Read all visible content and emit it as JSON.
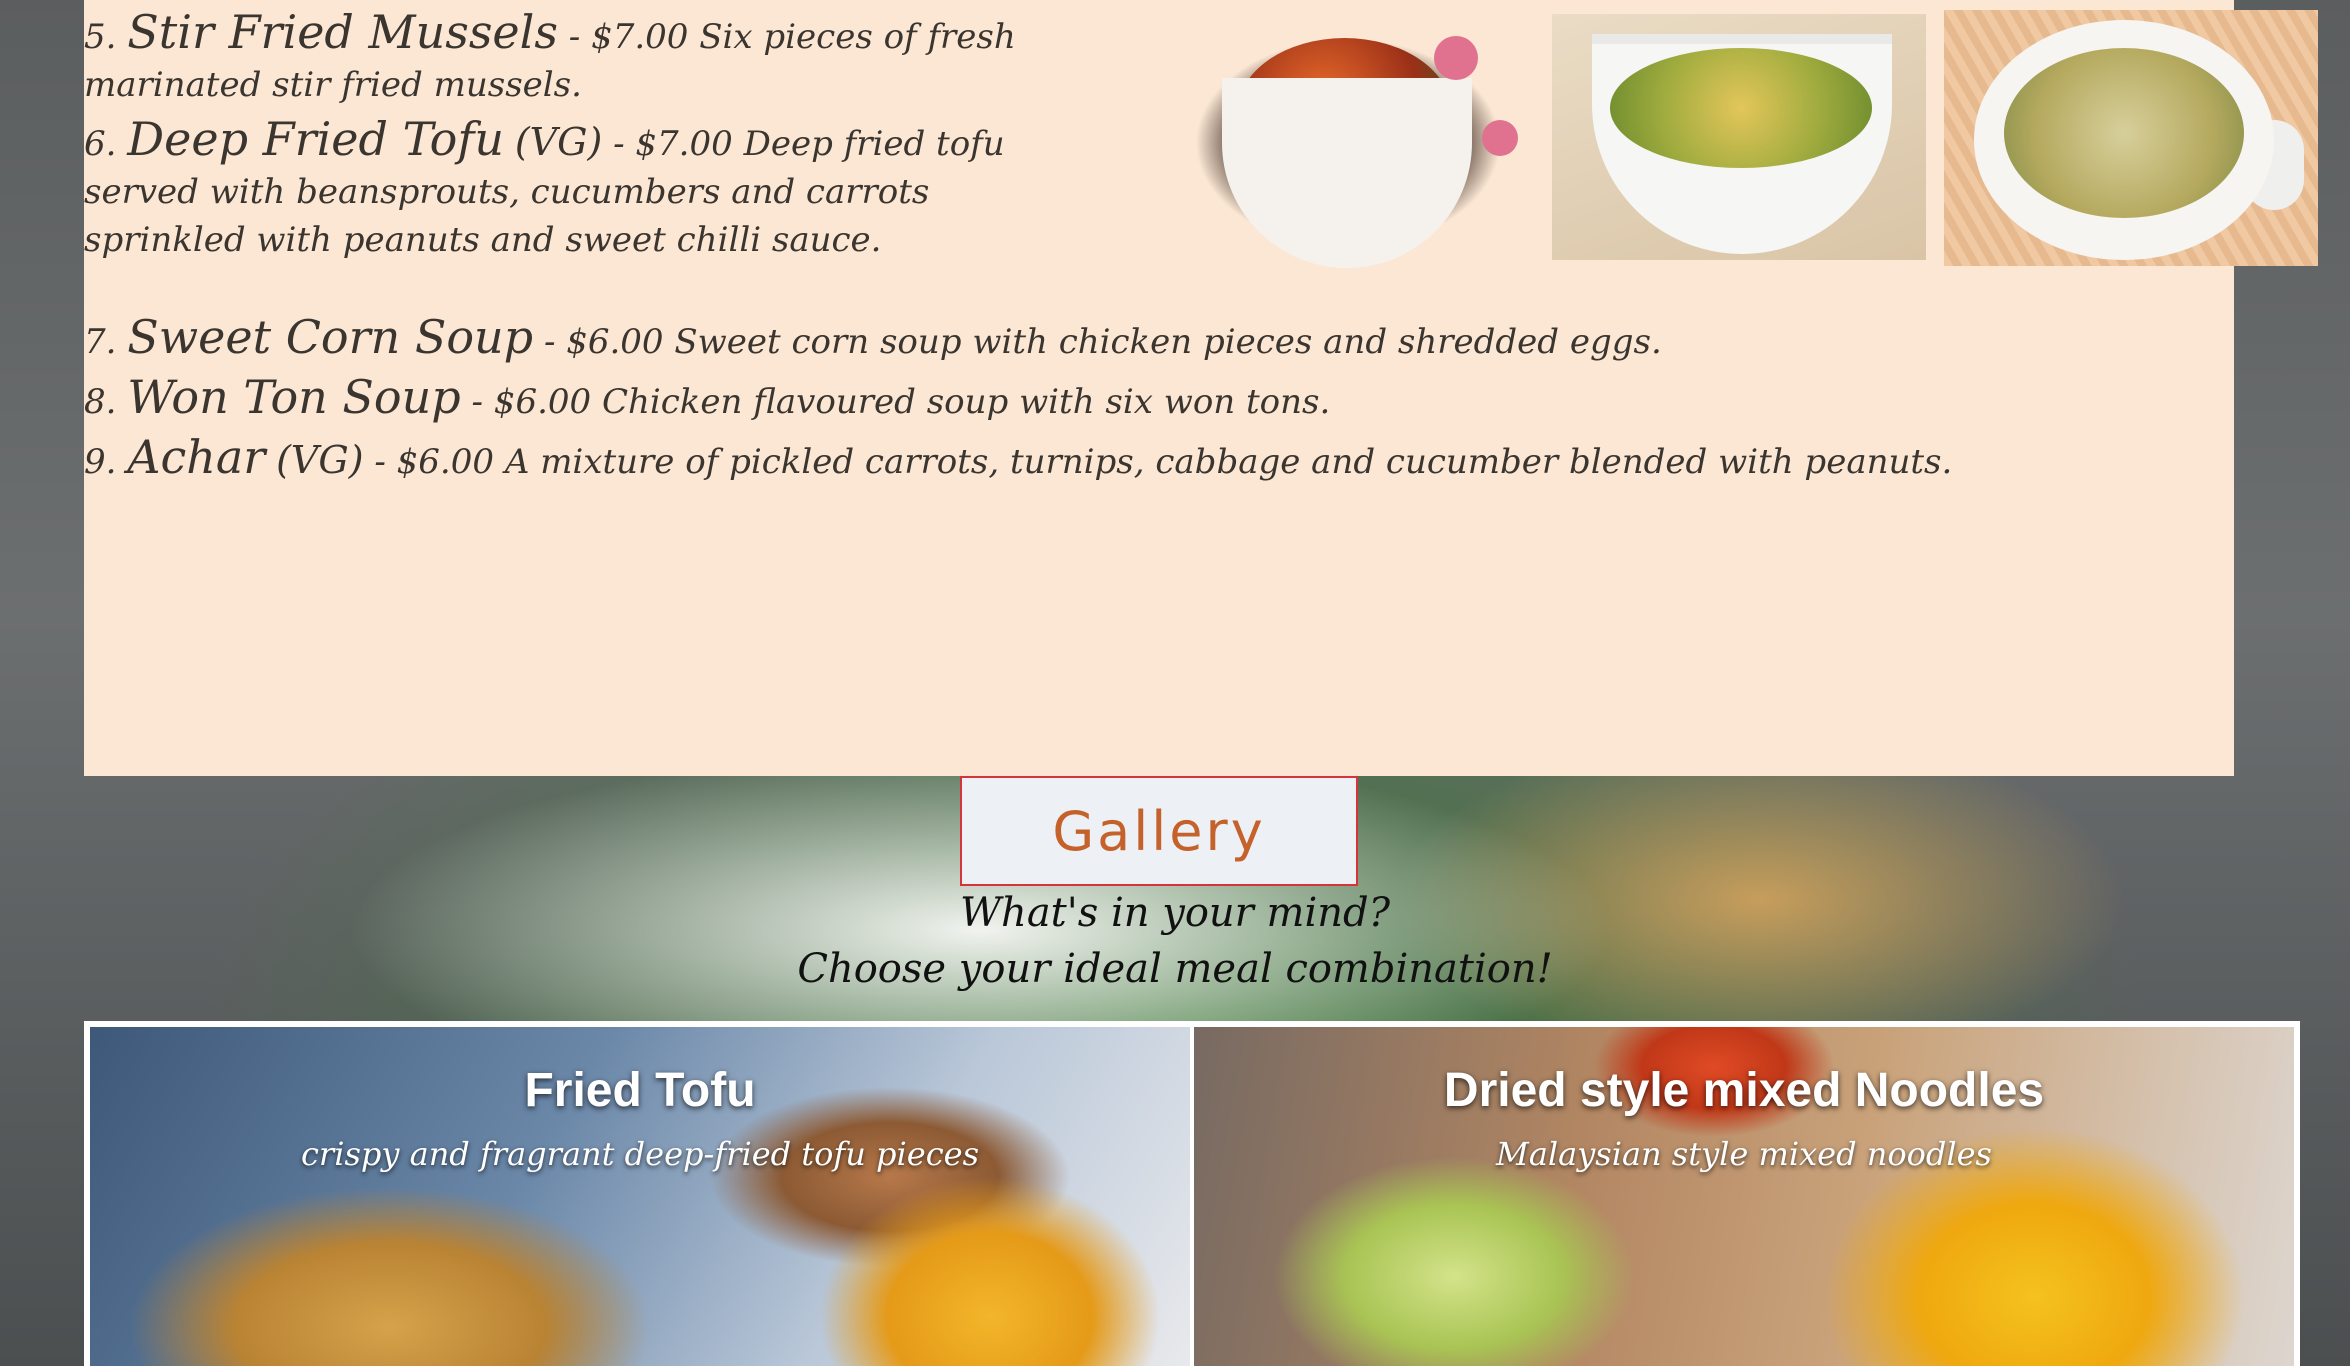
{
  "menu": {
    "items": [
      {
        "num": "5.",
        "name": "Stir Fried Mussels",
        "tag": "",
        "price": "- $7.00",
        "desc": "Six pieces of fresh marinated stir fried mussels."
      },
      {
        "num": "6.",
        "name": "Deep Fried Tofu",
        "tag": "(VG)",
        "price": "- $7.00",
        "desc": "Deep fried tofu served with beansprouts, cucumbers and carrots sprinkled with peanuts and sweet chilli sauce."
      },
      {
        "num": "7.",
        "name": "Sweet Corn Soup",
        "tag": "",
        "price": "- $6.00",
        "desc": "Sweet corn soup with chicken pieces and shredded eggs."
      },
      {
        "num": "8.",
        "name": "Won Ton Soup",
        "tag": "",
        "price": "- $6.00",
        "desc": "Chicken flavoured soup with six won tons."
      },
      {
        "num": "9.",
        "name": "Achar",
        "tag": "(VG)",
        "price": "- $6.00",
        "desc": "A mixture of pickled carrots, turnips, cabbage and cucumber blended with peanuts."
      }
    ]
  },
  "gallery": {
    "heading": "Gallery",
    "line1": "What's in your mind?",
    "line2": "Choose your ideal meal combination!",
    "cards": [
      {
        "title": "Fried Tofu",
        "subtitle": "crispy and fragrant deep-fried tofu pieces"
      },
      {
        "title": "Dried style mixed Noodles",
        "subtitle": "Malaysian style mixed noodles"
      }
    ]
  },
  "colors": {
    "menu_bg": "#fbe7d4",
    "gallery_heading_text": "#c5622b",
    "gallery_heading_border": "#d5343a"
  }
}
